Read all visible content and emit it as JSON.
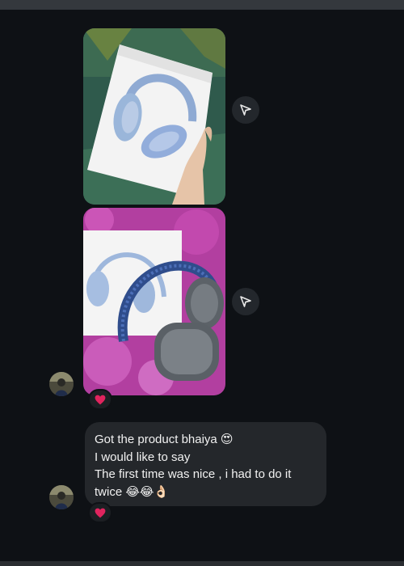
{
  "conversation": {
    "messages": [
      {
        "type": "photo",
        "alt_icon": "headphones-box-photo",
        "share_icon": "send-arrow-icon"
      },
      {
        "type": "photo",
        "alt_icon": "headphones-unboxed-photo",
        "share_icon": "send-arrow-icon",
        "reaction": "❤️"
      },
      {
        "type": "text",
        "lines": [
          "Got the product bhaiya 😍",
          "I would like to say",
          "The first time was nice , i had to do it",
          "twice 😂😂👌🏻"
        ],
        "reaction": "❤️"
      }
    ]
  },
  "colors": {
    "background": "#0e1115",
    "bubble": "#24272b",
    "share_button": "#23272c",
    "reaction_heart": "#e0245e"
  }
}
